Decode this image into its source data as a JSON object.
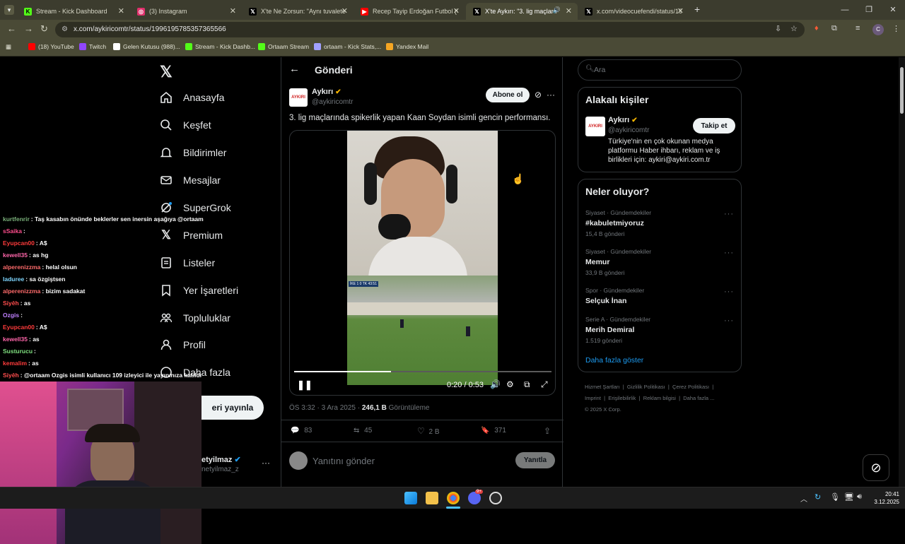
{
  "browser": {
    "tabs": [
      {
        "title": "Stream - Kick Dashboard",
        "icon": "kick-icon",
        "color": "#53fc18"
      },
      {
        "title": "(3) Instagram",
        "icon": "instagram-icon",
        "color": "#e1306c"
      },
      {
        "title": "X'te Ne Zorsun: \"Aynı tuvalete",
        "icon": "x-icon",
        "color": "#000000"
      },
      {
        "title": "Recep Tayip Erdoğan Futbol (G",
        "icon": "youtube-icon",
        "color": "#ff0000"
      },
      {
        "title": "X'te Aykırı: \"3. lig maçlarında",
        "icon": "x-icon",
        "color": "#000000"
      },
      {
        "title": "x.com/videocuefendi/status/19",
        "icon": "x-icon",
        "color": "#000000"
      }
    ],
    "url": "x.com/aykiricomtr/status/1996195785357365566",
    "bookmarks": [
      {
        "label": "(18) YouTube",
        "icon": "youtube-icon",
        "color": "#ff0000"
      },
      {
        "label": "Twitch",
        "icon": "twitch-icon",
        "color": "#9146ff"
      },
      {
        "label": "Gelen Kutusu (988)...",
        "icon": "mail-icon",
        "color": "#ffffff"
      },
      {
        "label": "Stream - Kick Dashb...",
        "icon": "kick-icon",
        "color": "#53fc18"
      },
      {
        "label": "Ortaam Stream",
        "icon": "kick-icon",
        "color": "#53fc18"
      },
      {
        "label": "ortaam - Kick Stats,...",
        "icon": "stats-icon",
        "color": "#a0a0ff"
      },
      {
        "label": "Yandex Mail",
        "icon": "yandex-mail-icon",
        "color": "#f5a623"
      }
    ]
  },
  "nav": {
    "items": [
      {
        "label": "Anasayfa",
        "icon": "home-icon"
      },
      {
        "label": "Keşfet",
        "icon": "search-icon"
      },
      {
        "label": "Bildirimler",
        "icon": "bell-icon"
      },
      {
        "label": "Mesajlar",
        "icon": "mail-icon"
      },
      {
        "label": "SuperGrok",
        "icon": "grok-icon"
      },
      {
        "label": "Premium",
        "icon": "x-icon"
      },
      {
        "label": "Listeler",
        "icon": "list-icon"
      },
      {
        "label": "Yer İşaretleri",
        "icon": "bookmark-icon"
      },
      {
        "label": "Topluluklar",
        "icon": "communities-icon"
      },
      {
        "label": "Profil",
        "icon": "profile-icon"
      },
      {
        "label": "Daha fazla",
        "icon": "more-icon"
      }
    ],
    "post_label": "eri yayınla",
    "account_name": "etyilmaz",
    "account_handle": "netyilmaz_z"
  },
  "chat": [
    {
      "user": "kurtfenrir",
      "msg": "Taş kasabın önünde beklerler sen inersin aşağıya @ortaam",
      "color": "#7ab07a"
    },
    {
      "user": "sSaika",
      "msg": "",
      "color": "#ff4d8d",
      "badge": "🏳"
    },
    {
      "user": "Eyupcan00",
      "msg": "A$",
      "color": "#ff3b3b"
    },
    {
      "user": "kewell35",
      "msg": "as hg",
      "color": "#ff66aa"
    },
    {
      "user": "alperenizzma",
      "msg": "helal olsun",
      "color": "#ff6b6b"
    },
    {
      "user": "laduree",
      "msg": "sa özgiştsen",
      "color": "#7fd6ff"
    },
    {
      "user": "alperenizzma",
      "msg": "bizim sadakat",
      "color": "#ff6b6b"
    },
    {
      "user": "Siyêh",
      "msg": "as",
      "color": "#ff4d4d"
    },
    {
      "user": "Ozgis",
      "msg": "",
      "color": "#c080ff"
    },
    {
      "user": "Eyupcan00",
      "msg": "A$",
      "color": "#ff3b3b"
    },
    {
      "user": "kewell35",
      "msg": "as",
      "color": "#ff66aa"
    },
    {
      "user": "Susturucu",
      "msg": "",
      "color": "#7fe07f"
    },
    {
      "user": "kemalim",
      "msg": "as",
      "color": "#ff3b3b"
    },
    {
      "user": "Siyêh",
      "msg": "@ortaam Ozgis isimli kullanıcı 109 izleyici ile yayınınıza katıldı",
      "color": "#ff4d4d"
    }
  ],
  "post": {
    "header_title": "Gönderi",
    "author_name": "Aykırı",
    "author_handle": "@aykiricomtr",
    "avatar_text": "AYKIRI",
    "subscribe_label": "Abone ol",
    "text": "3. lig maçlarında spikerlik yapan Kaan Soydan isimli gencin performansı.",
    "video_time": "0:20 / 0:53",
    "video_progress": 0.377,
    "score_overlay": "İKE 1 0 TK 43:51",
    "timestamp": "ÖS 3:32 · 3 Ara 2025 · ",
    "views_count": "246,1 B",
    "views_label": " Görüntüleme",
    "replies": "83",
    "reposts": "45",
    "likes": "2 B",
    "bookmarks": "371",
    "reply_placeholder": "Yanıtını gönder",
    "reply_button": "Yanıtla"
  },
  "sidebar": {
    "search_placeholder": "Ara",
    "related_title": "Alakalı kişiler",
    "related_name": "Aykırı",
    "related_handle": "@aykiricomtr",
    "related_bio": "Türkiye'nin en çok okunan medya platformu Haber ihbarı, reklam ve iş birlikleri için: aykiri@aykiri.com.tr",
    "follow_label": "Takip et",
    "trends_title": "Neler oluyor?",
    "trends": [
      {
        "meta": "Siyaset · Gündemdekiler",
        "name": "#kabuletmiyoruz",
        "count": "15,4 B gönderi"
      },
      {
        "meta": "Siyaset · Gündemdekiler",
        "name": "Memur",
        "count": "33,9 B gönderi"
      },
      {
        "meta": "Spor · Gündemdekiler",
        "name": "Selçuk İnan",
        "count": ""
      },
      {
        "meta": "Serie A · Gündemdekiler",
        "name": "Merih Demiral",
        "count": "1.519 gönderi"
      }
    ],
    "show_more": "Daha fazla göster",
    "footer_links": [
      "Hizmet Şartları",
      "Gizlilik Politikası",
      "Çerez Politikası",
      "Imprint",
      "Erişilebilirlik",
      "Reklam bilgisi",
      "Daha fazla ..."
    ],
    "copyright": "© 2025 X Corp."
  },
  "taskbar": {
    "time": "20:41",
    "date": "3.12.2025",
    "discord_badge": "9+"
  }
}
